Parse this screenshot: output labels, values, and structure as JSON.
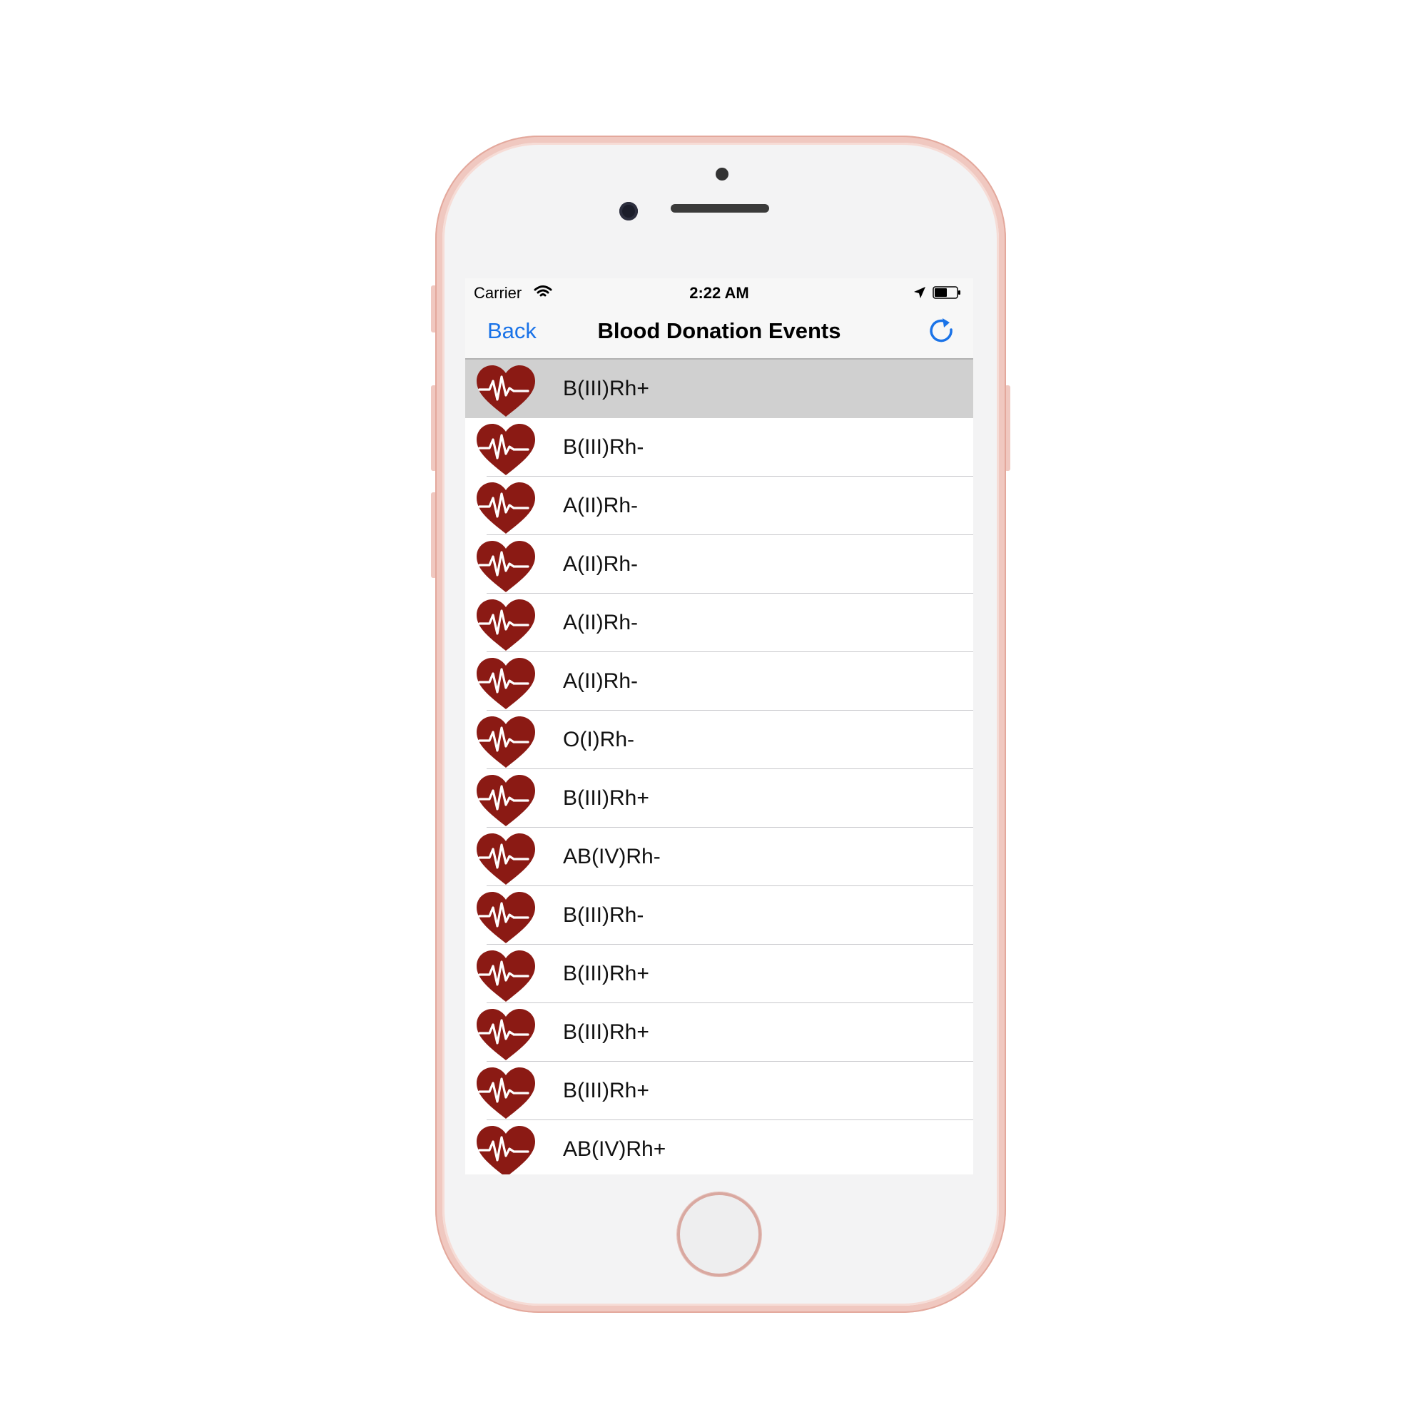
{
  "status_bar": {
    "carrier": "Carrier",
    "time": "2:22 AM",
    "icons": [
      "wifi-icon",
      "location-arrow-icon",
      "battery-icon"
    ]
  },
  "nav_bar": {
    "back_label": "Back",
    "title": "Blood Donation Events",
    "right_icon": "refresh-icon"
  },
  "colors": {
    "accent": "#1a73e8",
    "heart": "#8b1a14",
    "selected_row": "#d0d0d0",
    "phone_frame": "#f0c8c0"
  },
  "events": [
    {
      "label": "B(III)Rh+",
      "icon": "heart-pulse-icon",
      "selected": true
    },
    {
      "label": "B(III)Rh-",
      "icon": "heart-pulse-icon"
    },
    {
      "label": "A(II)Rh-",
      "icon": "heart-pulse-icon"
    },
    {
      "label": "A(II)Rh-",
      "icon": "heart-pulse-icon"
    },
    {
      "label": "A(II)Rh-",
      "icon": "heart-pulse-icon"
    },
    {
      "label": "A(II)Rh-",
      "icon": "heart-pulse-icon"
    },
    {
      "label": "O(I)Rh-",
      "icon": "heart-pulse-icon"
    },
    {
      "label": "B(III)Rh+",
      "icon": "heart-pulse-icon"
    },
    {
      "label": "AB(IV)Rh-",
      "icon": "heart-pulse-icon"
    },
    {
      "label": "B(III)Rh-",
      "icon": "heart-pulse-icon"
    },
    {
      "label": "B(III)Rh+",
      "icon": "heart-pulse-icon"
    },
    {
      "label": "B(III)Rh+",
      "icon": "heart-pulse-icon"
    },
    {
      "label": "B(III)Rh+",
      "icon": "heart-pulse-icon"
    },
    {
      "label": "AB(IV)Rh+",
      "icon": "heart-pulse-icon"
    }
  ]
}
